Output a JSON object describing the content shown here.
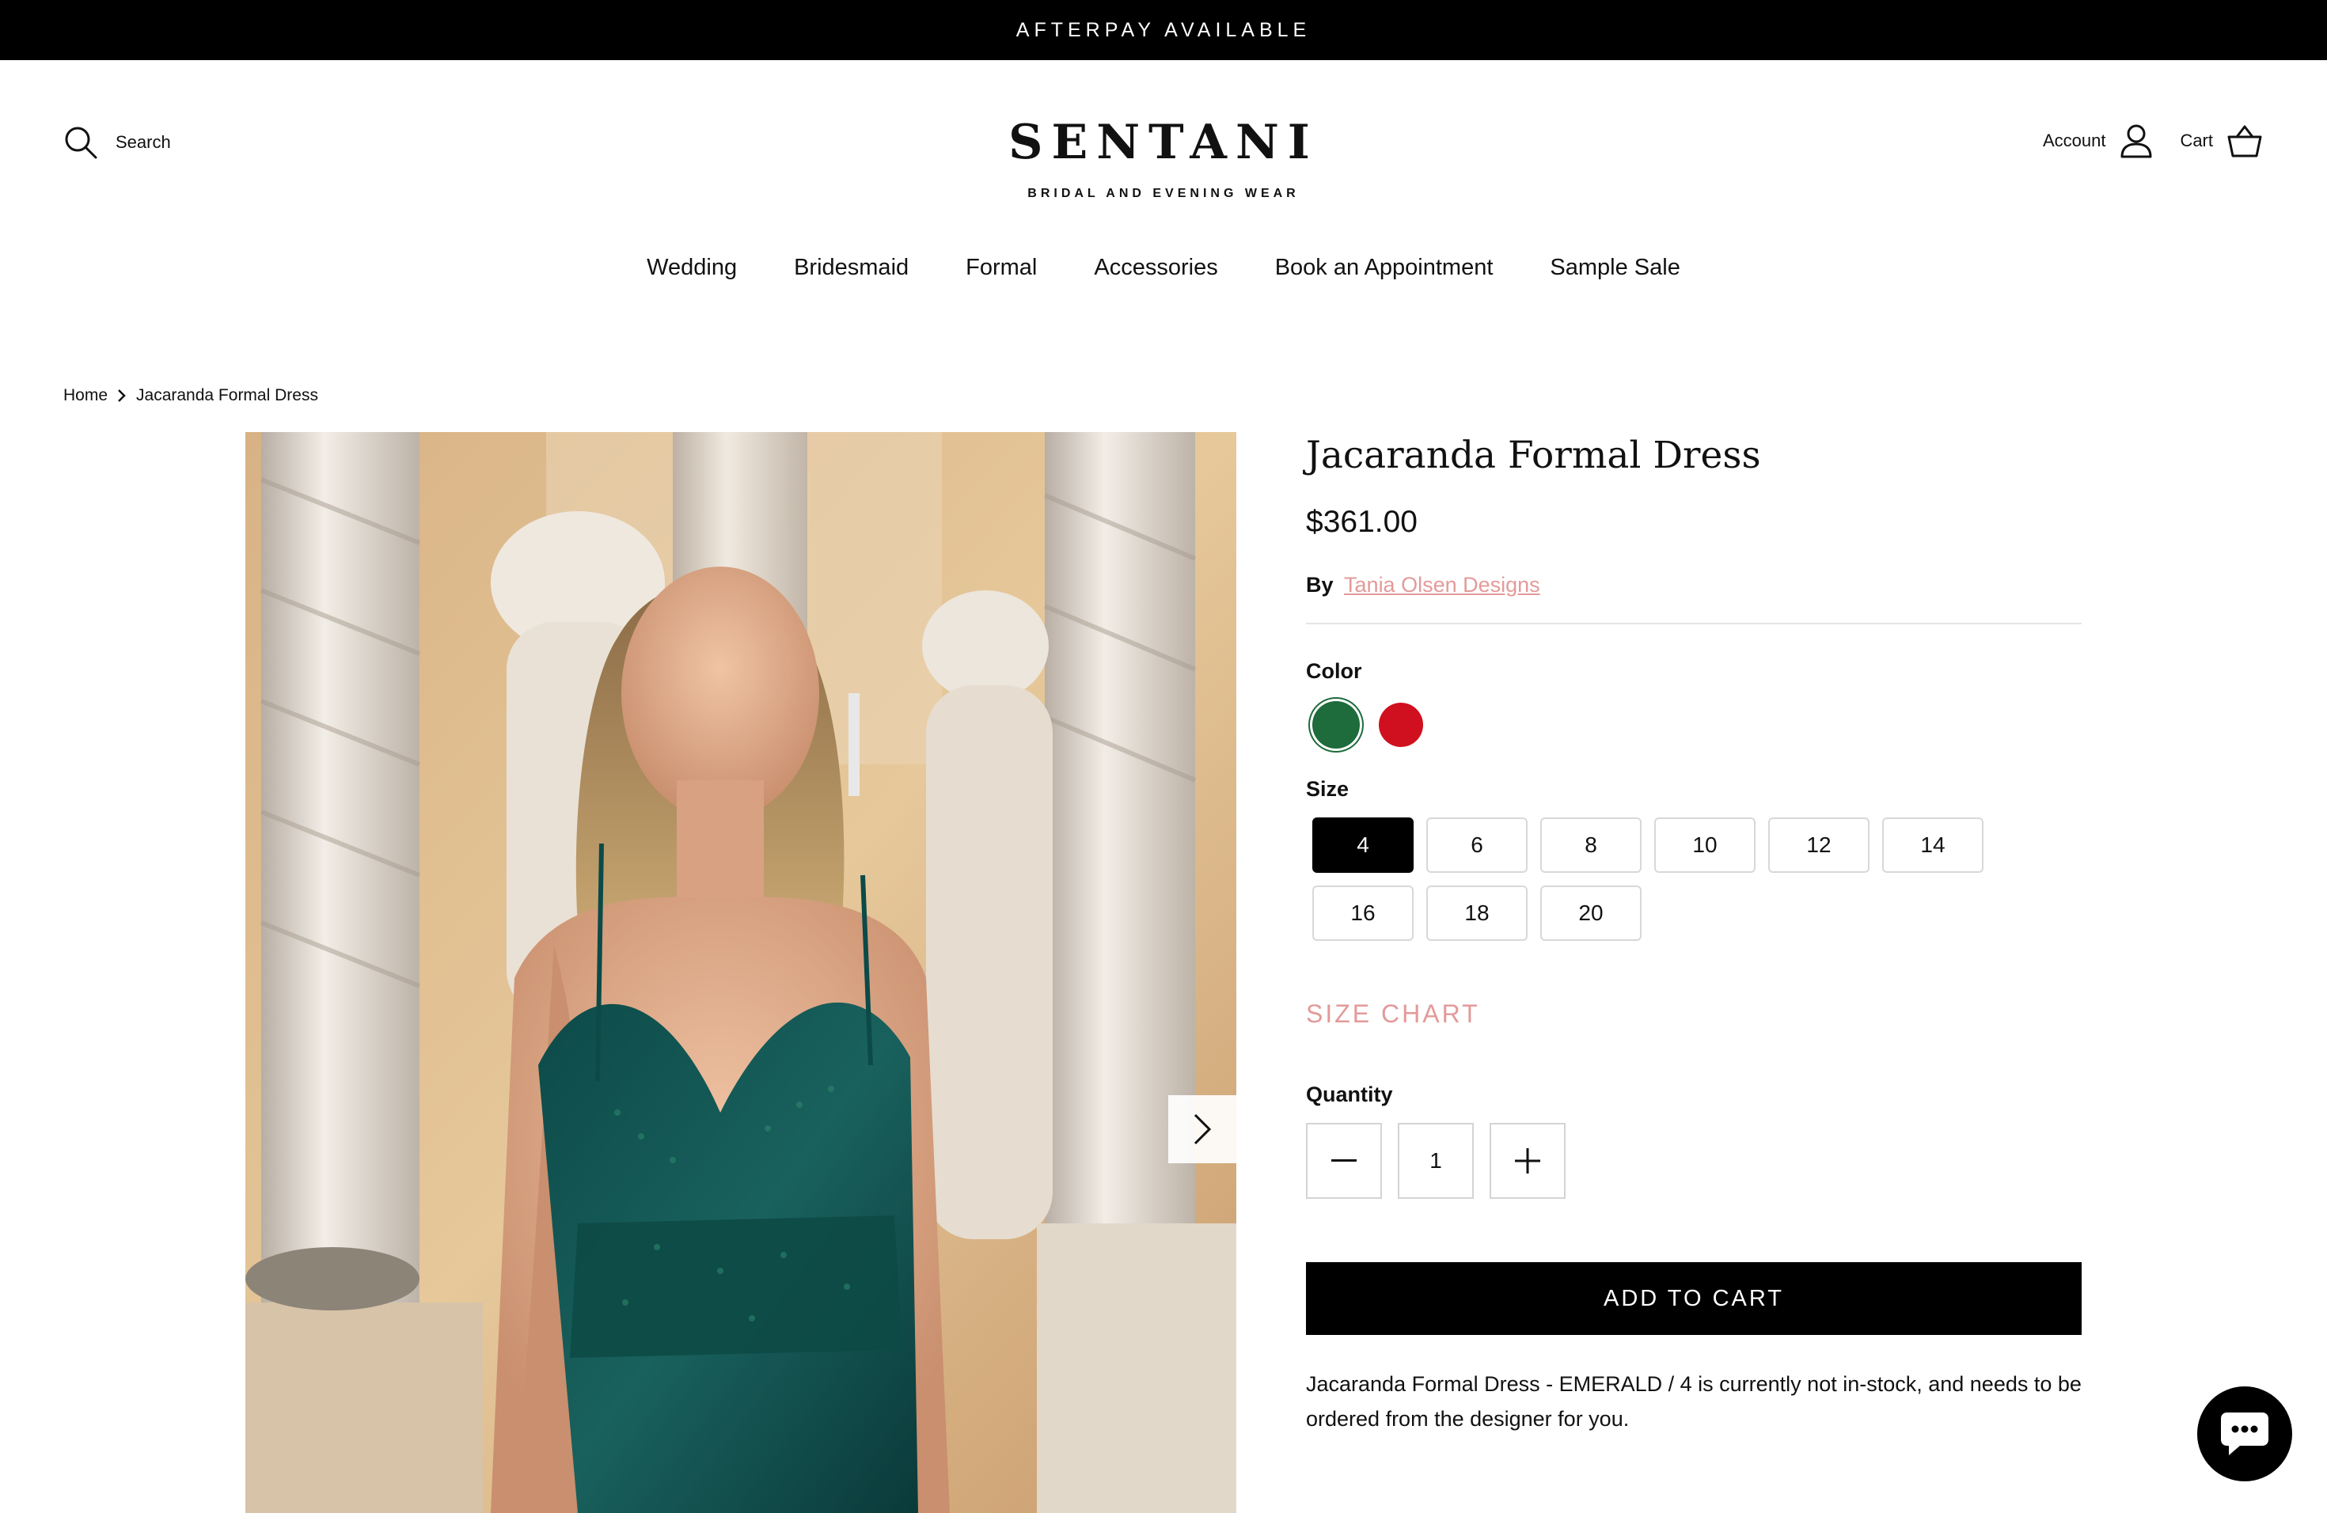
{
  "announcement": "AFTERPAY AVAILABLE",
  "header": {
    "search_label": "Search",
    "logo_word": "SENTANI",
    "logo_tagline": "BRIDAL AND EVENING WEAR",
    "account_label": "Account",
    "cart_label": "Cart"
  },
  "nav": [
    "Wedding",
    "Bridesmaid",
    "Formal",
    "Accessories",
    "Book an Appointment",
    "Sample Sale"
  ],
  "breadcrumb": {
    "home": "Home",
    "current": "Jacaranda Formal Dress"
  },
  "product": {
    "title": "Jacaranda Formal Dress",
    "price": "$361.00",
    "by_label": "By",
    "vendor": "Tania Olsen Designs",
    "color_label": "Color",
    "colors": [
      {
        "name": "emerald",
        "hex": "#1e6b3c"
      },
      {
        "name": "red",
        "hex": "#d0101e"
      }
    ],
    "size_label": "Size",
    "sizes": [
      "4",
      "6",
      "8",
      "10",
      "12",
      "14",
      "16",
      "18",
      "20"
    ],
    "selected_size": "4",
    "size_chart": "SIZE CHART",
    "quantity_label": "Quantity",
    "quantity": "1",
    "add_to_cart": "ADD TO CART",
    "stock_note": "Jacaranda Formal Dress - EMERALD / 4 is currently not in-stock, and needs to be ordered from the designer for you."
  },
  "colors": {
    "accent_pink": "#e39a9a",
    "black": "#000000"
  }
}
